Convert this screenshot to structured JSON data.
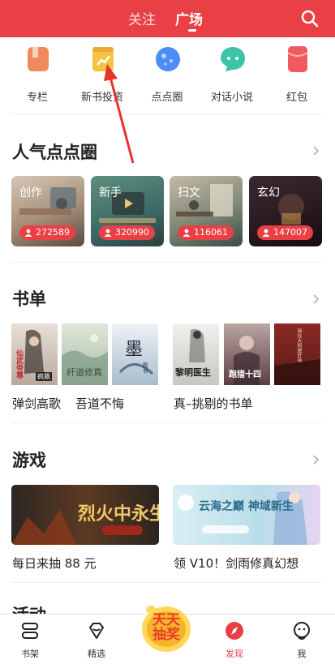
{
  "header": {
    "tab_follow": "关注",
    "tab_square": "广场",
    "accent": "#e94046"
  },
  "quick_entries": [
    {
      "label": "专栏",
      "icon": "book-bookmark-icon",
      "color": "#f08a5d"
    },
    {
      "label": "新书投资",
      "icon": "growth-chart-icon",
      "color": "#f5c242"
    },
    {
      "label": "点点圈",
      "icon": "bubble-planet-icon",
      "color": "#4c8cf5"
    },
    {
      "label": "对话小说",
      "icon": "chat-bubble-icon",
      "color": "#3cc3a8"
    },
    {
      "label": "红包",
      "icon": "red-envelope-icon",
      "color": "#f05a5f"
    }
  ],
  "popular_circles": {
    "title": "人气点点圈",
    "items": [
      {
        "name": "创作",
        "count": "272589"
      },
      {
        "name": "新手",
        "count": "320990"
      },
      {
        "name": "扫文",
        "count": "116061"
      },
      {
        "name": "玄幻",
        "count": "147007"
      }
    ]
  },
  "booklists": {
    "title": "书单",
    "items": [
      {
        "label": "弹剑高歌",
        "cover_texts": [
          "仙武帝尊",
          "疯飙"
        ]
      },
      {
        "label": "吾道不悔",
        "cover_texts": [
          "纤道修真"
        ]
      },
      {
        "label": "",
        "cover_texts": [
          "墨",
          "昂书"
        ]
      },
      {
        "label": "真–挑剔的书单",
        "cover_texts": [
          "黎明医生",
          "跑猎十四",
          "我在大明做奸商"
        ]
      }
    ]
  },
  "games": {
    "title": "游戏",
    "items": [
      {
        "label": "每日来抽 88 元",
        "banner_text": "烈火中永生"
      },
      {
        "label": "领 V10！剑雨修真幻想",
        "banner_text": "云海之巅 神域新生"
      }
    ]
  },
  "activity": {
    "title": "活动"
  },
  "bottom_nav": {
    "items": [
      {
        "label": "书架",
        "icon": "bookshelf-icon"
      },
      {
        "label": "精选",
        "icon": "diamond-icon"
      },
      {
        "label": "发现",
        "icon": "compass-icon",
        "active": true
      },
      {
        "label": "我",
        "icon": "face-icon"
      }
    ],
    "lottery": "天天抽奖"
  }
}
